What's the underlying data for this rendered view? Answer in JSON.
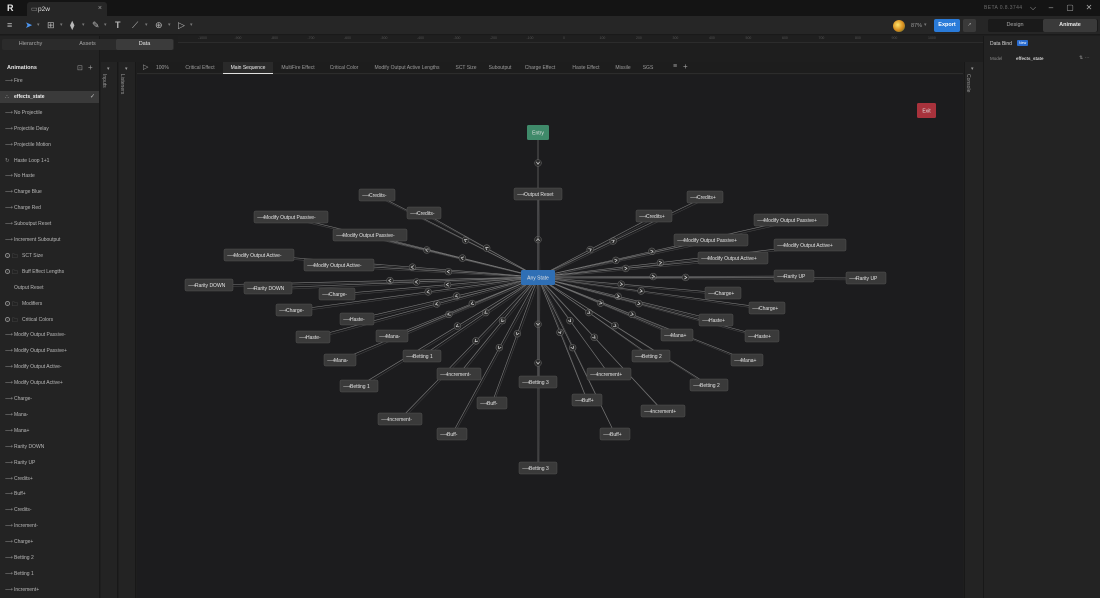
{
  "window": {
    "tab_title": "p2w",
    "tab_icon": "file-icon",
    "close_glyph": "×",
    "version": "BETA 0.8.3744",
    "logo": "R",
    "minimize_glyph": "–",
    "maximize_glyph": "▢",
    "close_window_glyph": "✕",
    "collapse_glyph": "⌵"
  },
  "toolbar": {
    "menu_icon": "≡",
    "zoom": "87%",
    "export_label": "Export",
    "share_label": "↗",
    "modes": [
      "Design",
      "Animate"
    ],
    "active_mode": "Animate"
  },
  "left_panel": {
    "tabs": [
      "Hierarchy",
      "Assets",
      "Data"
    ],
    "active_tab": "Data",
    "animations_title": "Animations",
    "items": [
      {
        "label": "Fire",
        "type": "animation"
      },
      {
        "label": "effects_state",
        "type": "state-machine",
        "selected": true
      },
      {
        "label": "No Projectile",
        "type": "animation"
      },
      {
        "label": "Projectile Delay",
        "type": "animation"
      },
      {
        "label": "Projectile Motion",
        "type": "animation"
      },
      {
        "label": "Haste Loop 1+1",
        "type": "loop"
      },
      {
        "label": "No Haste",
        "type": "animation"
      },
      {
        "label": "Charge Blue",
        "type": "animation"
      },
      {
        "label": "Charge Red",
        "type": "animation"
      },
      {
        "label": "Suboutput Reset",
        "type": "animation"
      },
      {
        "label": "Increment Suboutput",
        "type": "animation"
      },
      {
        "label": "SCT Size",
        "type": "folder"
      },
      {
        "label": "Buff Effect Lengths",
        "type": "folder"
      },
      {
        "label": "Output Reset",
        "type": "animation-plain"
      },
      {
        "label": "Modifiers",
        "type": "folder"
      },
      {
        "label": "Critical Colors",
        "type": "folder"
      },
      {
        "label": "Modify Output Passive-",
        "type": "animation"
      },
      {
        "label": "Modify Output Passive+",
        "type": "animation"
      },
      {
        "label": "Modify Output Active-",
        "type": "animation"
      },
      {
        "label": "Modify Output Active+",
        "type": "animation"
      },
      {
        "label": "Charge-",
        "type": "animation"
      },
      {
        "label": "Mana-",
        "type": "animation"
      },
      {
        "label": "Mana+",
        "type": "animation"
      },
      {
        "label": "Rarity DOWN",
        "type": "animation"
      },
      {
        "label": "Rarity UP",
        "type": "animation"
      },
      {
        "label": "Credits+",
        "type": "animation"
      },
      {
        "label": "Buff+",
        "type": "animation"
      },
      {
        "label": "Credits-",
        "type": "animation"
      },
      {
        "label": "Increment-",
        "type": "animation"
      },
      {
        "label": "Charge+",
        "type": "animation"
      },
      {
        "label": "Betting 2",
        "type": "animation"
      },
      {
        "label": "Betting 1",
        "type": "animation"
      },
      {
        "label": "Increment+",
        "type": "animation"
      }
    ]
  },
  "side_strips": {
    "inputs": "Inputs",
    "listeners": "Listeners",
    "console": "Console"
  },
  "ruler_ticks": [
    "-1000",
    "-900",
    "-800",
    "-700",
    "-600",
    "-500",
    "-400",
    "-300",
    "-200",
    "-100",
    "0",
    "100",
    "200",
    "300",
    "400",
    "500",
    "600",
    "700",
    "800",
    "900",
    "1000"
  ],
  "state_machine": {
    "zoom": "100%",
    "layers": [
      "Critical Effect",
      "Main Sequence",
      "MultiFire Effect",
      "Critical Color",
      "Modify Output Active Lengths",
      "SCT Size",
      "Suboutput",
      "Charge Effect",
      "Haste Effect",
      "Missile",
      "SGS"
    ],
    "active_layer": "Main Sequence"
  },
  "right_panel": {
    "databind_label": "Data Bind",
    "new_badge": "New",
    "model_label": "Model",
    "model_value": "effects_state"
  },
  "graph": {
    "hub": "Any State",
    "entry": "Entry",
    "exit": "Exit",
    "states": [
      "Output Reset",
      "Credits-",
      "Credits-",
      "Credits+",
      "Credits+",
      "Modify Output Passive-",
      "Modify Output Passive-",
      "Modify Output Passive+",
      "Modify Output Passive+",
      "Modify Output Active-",
      "Modify Output Active-",
      "Modify Output Active+",
      "Modify Output Active+",
      "Rarity DOWN",
      "Rarity DOWN",
      "Rarity UP",
      "Rarity UP",
      "Charge-",
      "Charge-",
      "Charge+",
      "Charge+",
      "Haste-",
      "Haste-",
      "Haste+",
      "Haste+",
      "Mana-",
      "Mana-",
      "Mana+",
      "Mana+",
      "Betting 1",
      "Betting 1",
      "Betting 2",
      "Betting 2",
      "Betting 3",
      "Betting 3",
      "Increment-",
      "Increment-",
      "Increment+",
      "Increment+",
      "Buff-",
      "Buff-",
      "Buff+",
      "Buff+"
    ],
    "colors": {
      "hub": "#2f6fb5",
      "entry": "#3f8a6a",
      "exit": "#a8323c",
      "node": "#3a3a3a",
      "line": "#7e7e7e"
    }
  }
}
